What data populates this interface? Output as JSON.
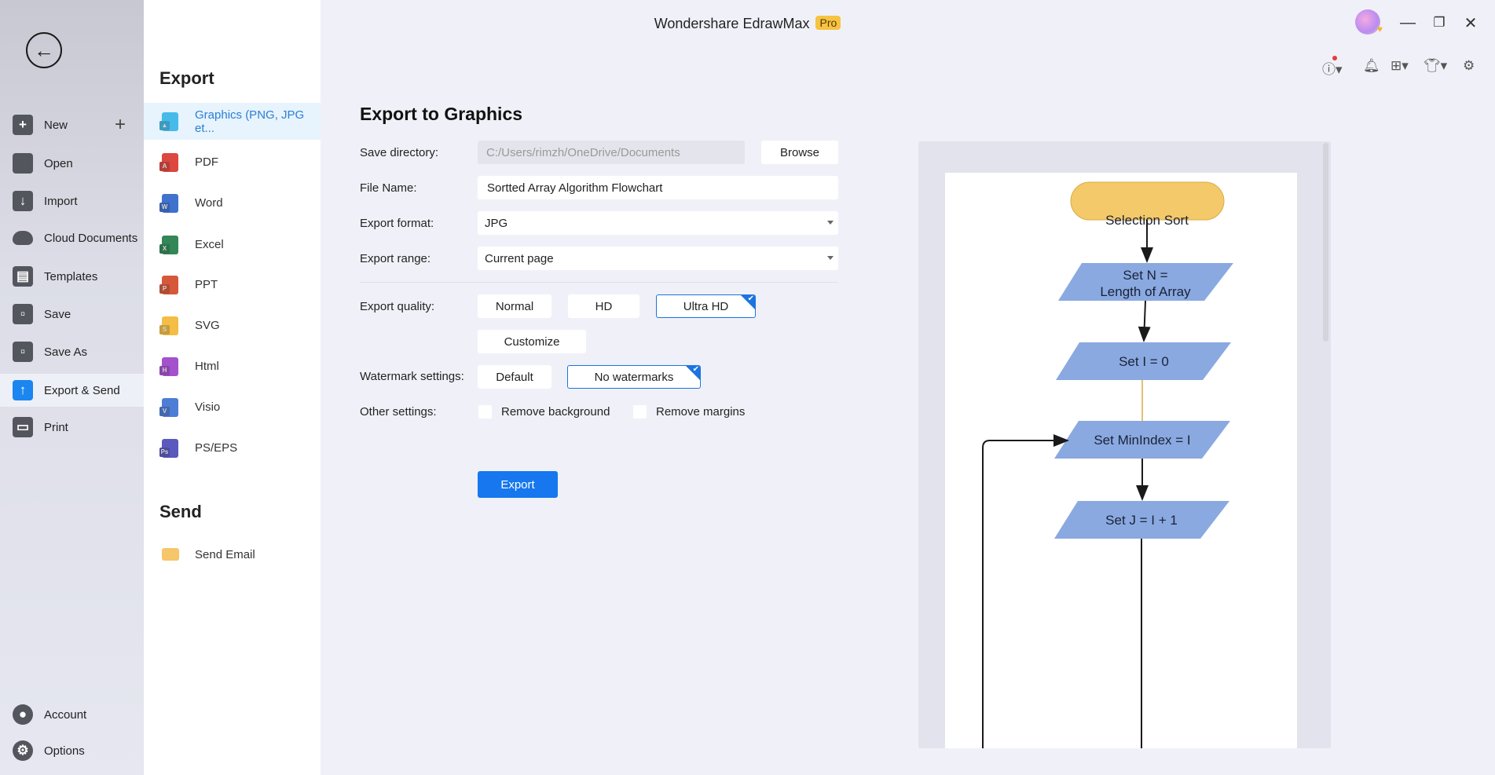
{
  "window": {
    "app_title": "Wondershare EdrawMax",
    "badge": "Pro"
  },
  "sidebar": {
    "items": [
      {
        "label": "New",
        "icon": "plus-square-icon"
      },
      {
        "label": "Open",
        "icon": "folder-icon"
      },
      {
        "label": "Import",
        "icon": "import-icon"
      },
      {
        "label": "Cloud Documents",
        "icon": "cloud-icon"
      },
      {
        "label": "Templates",
        "icon": "templates-icon"
      },
      {
        "label": "Save",
        "icon": "save-icon"
      },
      {
        "label": "Save As",
        "icon": "save-as-icon"
      },
      {
        "label": "Export & Send",
        "icon": "export-icon",
        "active": true
      },
      {
        "label": "Print",
        "icon": "print-icon"
      }
    ],
    "bottom": [
      {
        "label": "Account",
        "icon": "account-icon"
      },
      {
        "label": "Options",
        "icon": "gear-icon"
      }
    ]
  },
  "panel": {
    "export_heading": "Export",
    "formats": [
      {
        "label": "Graphics (PNG, JPG et...",
        "color": "#35b6e8",
        "letter": "▲",
        "active": true
      },
      {
        "label": "PDF",
        "color": "#d9342b",
        "letter": "A"
      },
      {
        "label": "Word",
        "color": "#2b63c9",
        "letter": "W"
      },
      {
        "label": "Excel",
        "color": "#1d7a45",
        "letter": "X"
      },
      {
        "label": "PPT",
        "color": "#d24726",
        "letter": "P"
      },
      {
        "label": "SVG",
        "color": "#f2b632",
        "letter": "S"
      },
      {
        "label": "Html",
        "color": "#9b3fc9",
        "letter": "H"
      },
      {
        "label": "Visio",
        "color": "#3a6fd1",
        "letter": "V"
      },
      {
        "label": "PS/EPS",
        "color": "#4a47b8",
        "letter": "Ps"
      }
    ],
    "send_heading": "Send",
    "send_items": [
      {
        "label": "Send Email",
        "icon": "email-icon"
      }
    ]
  },
  "form": {
    "title": "Export to Graphics",
    "save_dir_label": "Save directory:",
    "save_dir_value": "C:/Users/rimzh/OneDrive/Documents",
    "browse": "Browse",
    "file_name_label": "File Name:",
    "file_name_value": "Sortted Array Algorithm Flowchart",
    "format_label": "Export format:",
    "format_value": "JPG",
    "range_label": "Export range:",
    "range_value": "Current page",
    "quality_label": "Export quality:",
    "quality_options": [
      "Normal",
      "HD",
      "Ultra HD"
    ],
    "quality_selected": "Ultra HD",
    "customize": "Customize",
    "watermark_label": "Watermark settings:",
    "watermark_options": [
      "Default",
      "No watermarks"
    ],
    "watermark_selected": "No watermarks",
    "other_label": "Other settings:",
    "remove_background": "Remove background",
    "remove_background_checked": false,
    "remove_margins": "Remove margins",
    "remove_margins_checked": false,
    "export_button": "Export"
  },
  "preview": {
    "nodes": [
      "Selection Sort",
      "Set N =",
      "Length of Array",
      "Set I = 0",
      "Set MinIndex = I",
      "Set J = I + 1"
    ],
    "colors": {
      "terminator": "#f3c969",
      "process": "#8aa9e0",
      "accent": "#1677ef"
    }
  }
}
